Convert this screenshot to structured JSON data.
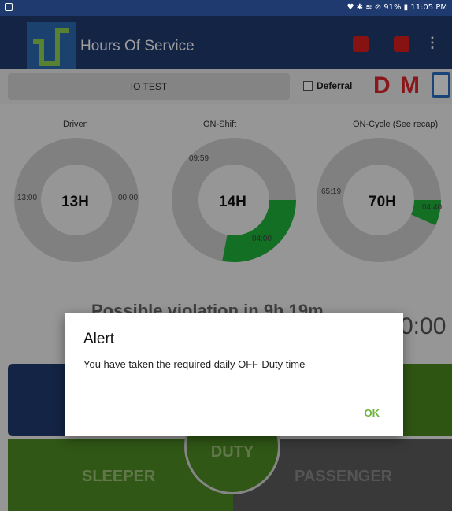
{
  "status_bar": {
    "right_text": "♥ ✱ ≋ ⊘ 91% ▮ 11:05 PM"
  },
  "app_bar": {
    "title": "Hours Of Service",
    "more_icon": "⋮"
  },
  "driver": {
    "name": "IO TEST",
    "deferral_label": "Deferral",
    "d_label": "D",
    "m_label": "M"
  },
  "gauges": [
    {
      "label": "Driven",
      "center": "13H",
      "left_value": "13:00",
      "right_value": "00:00"
    },
    {
      "label": "ON-Shift",
      "center": "14H",
      "top_value": "09:59",
      "bottom_value": "04:00",
      "used_fraction": 0.28
    },
    {
      "label": "ON-Cycle (See recap)",
      "center": "70H",
      "left_value": "65:19",
      "right_value": "04:40",
      "used_fraction": 0.067
    }
  ],
  "violation_text": "Possible violation in 9h 19m",
  "clock_text": "0:00",
  "status_buttons": {
    "sleeper": "SLEEPER",
    "passenger": "PASSENGER",
    "duty": "DUTY"
  },
  "alert": {
    "title": "Alert",
    "message": "You have taken the required daily OFF-Duty time",
    "ok_label": "OK"
  },
  "colors": {
    "app_bar": "#1f3a6e",
    "used_green": "#1fb43a",
    "ring_gray": "#cfcfcf",
    "accent_red": "#e0252b",
    "ok_green": "#6cb43a"
  }
}
